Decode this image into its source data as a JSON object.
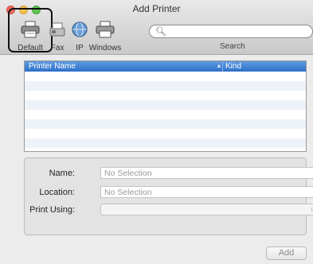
{
  "window": {
    "title": "Add Printer"
  },
  "toolbar": {
    "items": [
      {
        "label": "Default",
        "icon": "default-printer-icon"
      },
      {
        "label": "Fax",
        "icon": "fax-icon"
      },
      {
        "label": "IP",
        "icon": "ip-globe-icon"
      },
      {
        "label": "Windows",
        "icon": "windows-printer-icon"
      }
    ],
    "search_label": "Search",
    "search_placeholder": ""
  },
  "printer_list": {
    "columns": [
      "Printer Name",
      "Kind"
    ],
    "rows": []
  },
  "details": {
    "name_label": "Name:",
    "name_value": "No Selection",
    "location_label": "Location:",
    "location_value": "No Selection",
    "print_using_label": "Print Using:",
    "print_using_value": ""
  },
  "buttons": {
    "add_label": "Add"
  },
  "colors": {
    "header_blue": "#3b7bd2",
    "close": "#ef6a5e",
    "minimize": "#f4bf4f",
    "zoom": "#61c454"
  }
}
